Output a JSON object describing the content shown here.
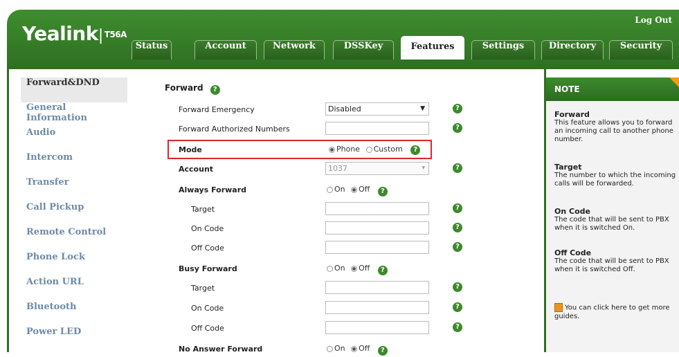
{
  "header": {
    "logo": "Yealink",
    "model": "T56A",
    "logout": "Log Out"
  },
  "tabs": [
    {
      "label": "Status"
    },
    {
      "label": "Account"
    },
    {
      "label": "Network"
    },
    {
      "label": "DSSKey"
    },
    {
      "label": "Features",
      "active": true
    },
    {
      "label": "Settings"
    },
    {
      "label": "Directory"
    },
    {
      "label": "Security"
    }
  ],
  "sidebar": {
    "items": [
      {
        "label": "Forward&DND",
        "active": true
      },
      {
        "label": "General Information"
      },
      {
        "label": "Audio"
      },
      {
        "label": "Intercom"
      },
      {
        "label": "Transfer"
      },
      {
        "label": "Call Pickup"
      },
      {
        "label": "Remote Control"
      },
      {
        "label": "Phone Lock"
      },
      {
        "label": "Action URL"
      },
      {
        "label": "Bluetooth"
      },
      {
        "label": "Power LED"
      }
    ]
  },
  "main": {
    "section_title": "Forward",
    "forward_emergency": {
      "label": "Forward Emergency",
      "value": "Disabled"
    },
    "forward_authorized": {
      "label": "Forward Authorized Numbers",
      "value": ""
    },
    "mode": {
      "label": "Mode",
      "opt1": "Phone",
      "opt2": "Custom",
      "selected": "Phone"
    },
    "account": {
      "label": "Account",
      "value": "1037"
    },
    "always_forward": {
      "label": "Always Forward",
      "on": "On",
      "off": "Off",
      "selected": "Off",
      "target": "Target",
      "on_code": "On Code",
      "off_code": "Off Code"
    },
    "busy_forward": {
      "label": "Busy Forward",
      "on": "On",
      "off": "Off",
      "selected": "Off",
      "target": "Target",
      "on_code": "On Code",
      "off_code": "Off Code"
    },
    "no_answer_forward": {
      "label": "No Answer Forward",
      "on": "On",
      "off": "Off",
      "selected": "Off"
    },
    "help_glyph": "?"
  },
  "note": {
    "title": "NOTE",
    "forward_title": "Forward",
    "forward_text": "This feature allows you to forward an incoming call to another phone number.",
    "target_title": "Target",
    "target_text": "The number to which the incoming calls will be forwarded.",
    "oncode_title": "On Code",
    "oncode_text": "The code that will be sent to PBX when it is switched On.",
    "offcode_title": "Off Code",
    "offcode_text": "The code that will be sent to PBX when it is switched Off.",
    "guide_text": "You can click here to get more guides."
  },
  "colors": {
    "brand_green": "#3f8d2e",
    "highlight_red": "#d9262a",
    "note_corner": "#f39c12"
  }
}
